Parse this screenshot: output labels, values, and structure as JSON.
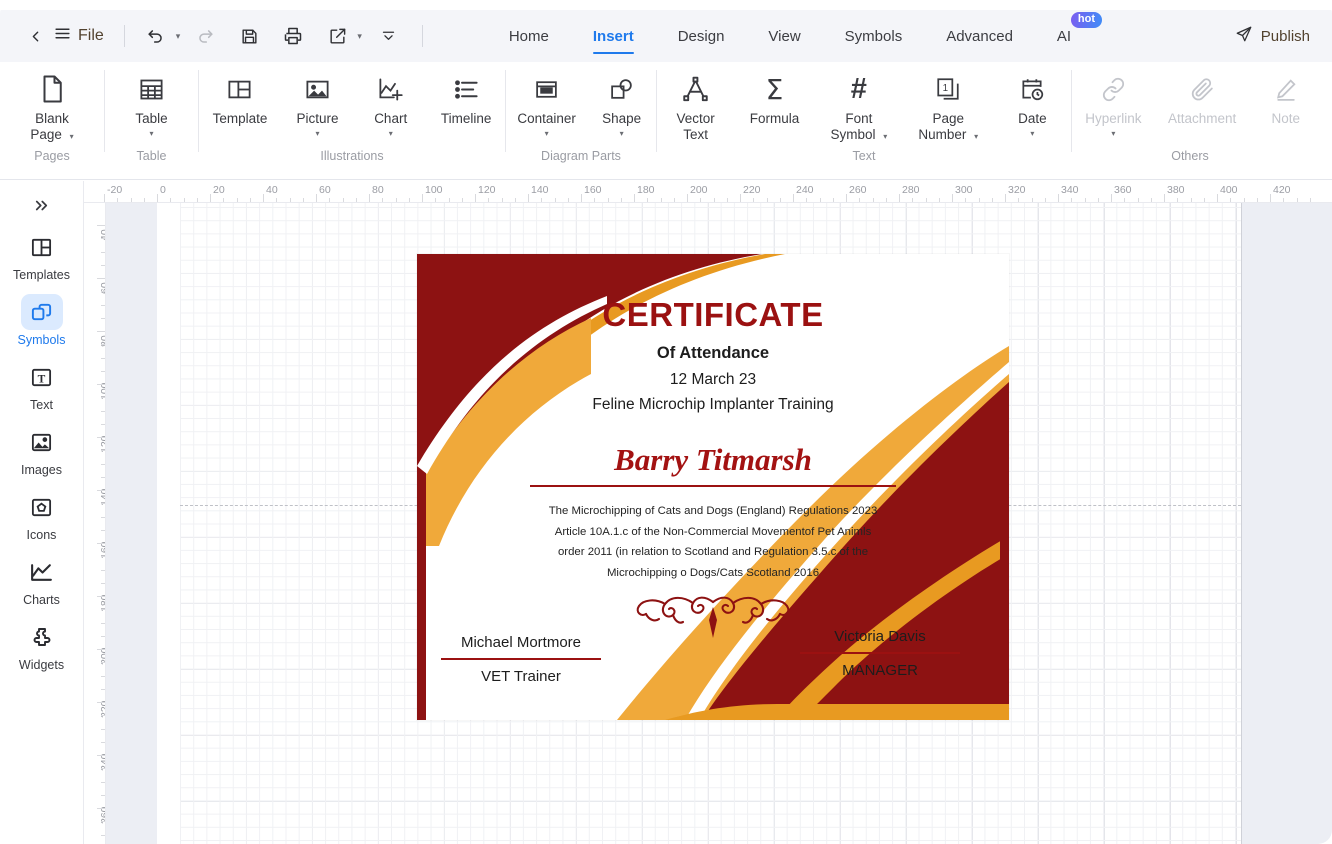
{
  "app": {
    "publish_label": "Publish",
    "file_label": "File"
  },
  "quickbar": [
    {
      "name": "back-icon",
      "label": "Back"
    },
    {
      "name": "menu-icon",
      "label": "Menu"
    },
    {
      "name": "undo-icon",
      "label": "Undo"
    },
    {
      "name": "redo-icon",
      "label": "Redo"
    },
    {
      "name": "save-icon",
      "label": "Save"
    },
    {
      "name": "print-icon",
      "label": "Print"
    },
    {
      "name": "export-icon",
      "label": "Export"
    },
    {
      "name": "more-icon",
      "label": "More"
    }
  ],
  "tabs": [
    {
      "label": "Home",
      "active": false
    },
    {
      "label": "Insert",
      "active": true
    },
    {
      "label": "Design",
      "active": false
    },
    {
      "label": "View",
      "active": false
    },
    {
      "label": "Symbols",
      "active": false
    },
    {
      "label": "Advanced",
      "active": false
    },
    {
      "label": "AI",
      "active": false,
      "badge": "hot"
    }
  ],
  "ribbon": {
    "groups": [
      {
        "label": "Pages",
        "items": [
          {
            "icon": "blank-page-icon",
            "label": "Blank\nPage",
            "caret": "inline",
            "disabled": false
          }
        ]
      },
      {
        "label": "Table",
        "items": [
          {
            "icon": "table-icon",
            "label": "Table",
            "caret": "below",
            "disabled": false
          }
        ]
      },
      {
        "label": "Illustrations",
        "items": [
          {
            "icon": "template-icon",
            "label": "Template",
            "caret": "none",
            "disabled": false
          },
          {
            "icon": "picture-icon",
            "label": "Picture",
            "caret": "below",
            "disabled": false
          },
          {
            "icon": "chart-icon",
            "label": "Chart",
            "caret": "below",
            "disabled": false
          },
          {
            "icon": "timeline-icon",
            "label": "Timeline",
            "caret": "none",
            "disabled": false
          }
        ]
      },
      {
        "label": "Diagram Parts",
        "items": [
          {
            "icon": "container-icon",
            "label": "Container",
            "caret": "below",
            "disabled": false
          },
          {
            "icon": "shape-icon",
            "label": "Shape",
            "caret": "below",
            "disabled": false
          }
        ]
      },
      {
        "label": "Text",
        "items": [
          {
            "icon": "vector-text-icon",
            "label": "Vector\nText",
            "caret": "none",
            "disabled": false
          },
          {
            "icon": "formula-icon",
            "label": "Formula",
            "caret": "none",
            "disabled": false
          },
          {
            "icon": "font-symbol-icon",
            "label": "Font\nSymbol",
            "caret": "inline",
            "disabled": false
          },
          {
            "icon": "page-number-icon",
            "label": "Page\nNumber",
            "caret": "inline",
            "disabled": false
          },
          {
            "icon": "date-icon",
            "label": "Date",
            "caret": "below",
            "disabled": false
          }
        ]
      },
      {
        "label": "Others",
        "items": [
          {
            "icon": "hyperlink-icon",
            "label": "Hyperlink",
            "caret": "below",
            "disabled": true
          },
          {
            "icon": "attachment-icon",
            "label": "Attachment",
            "caret": "none",
            "disabled": true
          },
          {
            "icon": "note-icon",
            "label": "Note",
            "caret": "none",
            "disabled": true
          }
        ]
      }
    ]
  },
  "sidebar": {
    "expand_label": "Expand",
    "items": [
      {
        "icon": "templates-icon",
        "label": "Templates",
        "active": false
      },
      {
        "icon": "symbols-icon",
        "label": "Symbols",
        "active": true
      },
      {
        "icon": "text-icon",
        "label": "Text",
        "active": false
      },
      {
        "icon": "images-icon",
        "label": "Images",
        "active": false
      },
      {
        "icon": "icons-icon",
        "label": "Icons",
        "active": false
      },
      {
        "icon": "charts-icon",
        "label": "Charts",
        "active": false
      },
      {
        "icon": "widgets-icon",
        "label": "Widgets",
        "active": false
      }
    ]
  },
  "rulers": {
    "horizontal_labels": [
      "-20",
      "0",
      "20",
      "40",
      "60",
      "80",
      "100",
      "120",
      "140",
      "160",
      "180",
      "200",
      "220",
      "240",
      "260",
      "280",
      "300",
      "320",
      "340",
      "360",
      "380",
      "400",
      "420"
    ],
    "vertical_labels": [
      "40",
      "60",
      "80",
      "100",
      "120",
      "140",
      "160",
      "180",
      "200",
      "220",
      "240",
      "260"
    ]
  },
  "certificate": {
    "title": "CERTIFICATE",
    "subtitle": "Of Attendance",
    "date": "12 March 23",
    "course": "Feline Microchip Implanter Training",
    "recipient": "Barry Titmarsh",
    "body_lines": [
      "The Microchipping of Cats and Dogs (England) Regulations 2023",
      "Article 10A.1.c of the Non-Commercial Movementof Pet Animls",
      "order 2011 (in relation to Scotland and Regulation 3.5.c of the",
      "Microchipping o Dogs/Cats Scotland 2016"
    ],
    "signature_left": {
      "name": "Michael Mortmore",
      "title": "VET Trainer"
    },
    "signature_right": {
      "name": "Victoria Davis",
      "title": "MANAGER"
    },
    "colors": {
      "dark_red": "#8d1212",
      "orange": "#e89a21",
      "light_orange": "#f0a93a",
      "title_red": "#9b1111"
    }
  }
}
